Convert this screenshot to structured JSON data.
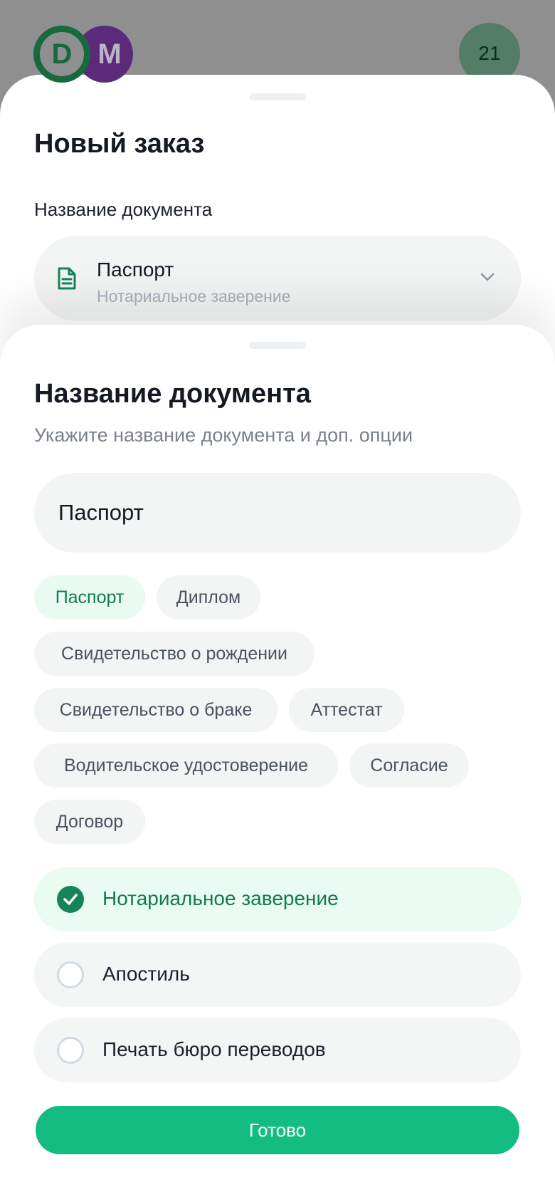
{
  "header": {
    "logo_letter_1": "D",
    "logo_letter_2": "M",
    "badge": "21"
  },
  "order_sheet": {
    "title": "Новый заказ",
    "field_label": "Название документа",
    "selected_document": {
      "name": "Паспорт",
      "option": "Нотариальное заверение",
      "icon": "document-icon",
      "dropdown_icon": "chevron-down-icon"
    }
  },
  "document_sheet": {
    "title": "Название документа",
    "subtitle": "Укажите название документа и доп. опции",
    "input_value": "Паспорт",
    "chips": [
      {
        "label": "Паспорт",
        "active": true
      },
      {
        "label": "Диплом",
        "active": false
      },
      {
        "label": "Свидетельство о рождении",
        "active": false
      },
      {
        "label": "Свидетельство о браке",
        "active": false
      },
      {
        "label": "Аттестат",
        "active": false
      },
      {
        "label": "Водительское удостоверение",
        "active": false
      },
      {
        "label": "Согласие",
        "active": false
      },
      {
        "label": "Договор",
        "active": false
      }
    ],
    "options": [
      {
        "label": "Нотариальное заверение",
        "checked": true
      },
      {
        "label": "Апостиль",
        "checked": false
      },
      {
        "label": "Печать бюро переводов",
        "checked": false
      }
    ],
    "done_label": "Готово"
  },
  "colors": {
    "accent": "#13bc7f",
    "accent_dark": "#148556",
    "chip_active_bg": "#e9fbf1",
    "logo_green": "#166a3e",
    "logo_purple": "#5b2a7a"
  }
}
